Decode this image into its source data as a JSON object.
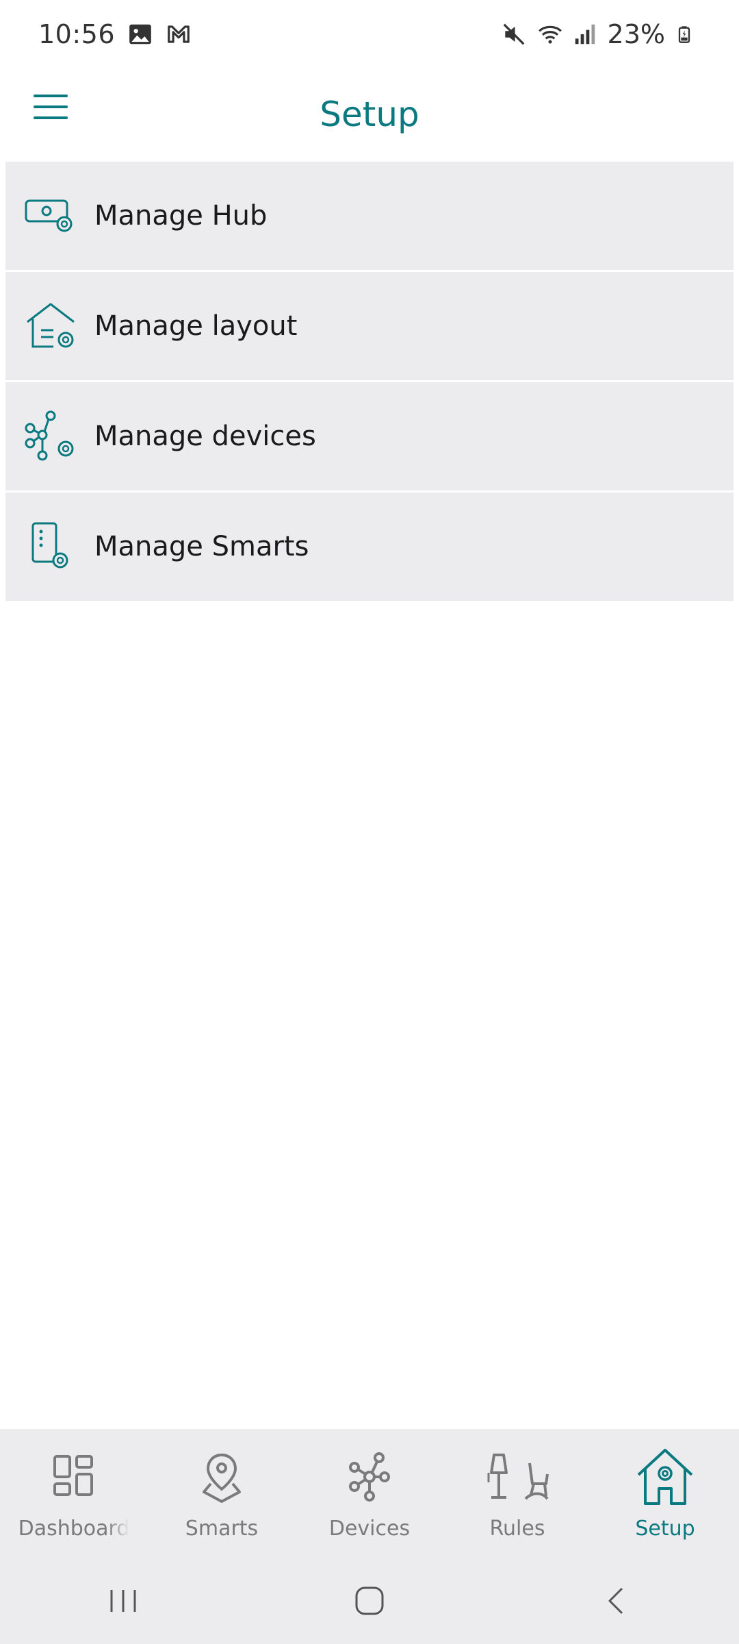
{
  "status_bar": {
    "time": "10:56",
    "battery": "23%",
    "icons": [
      "image-icon",
      "gmail-icon",
      "mute-icon",
      "wifi-icon",
      "signal-icon",
      "battery-icon"
    ]
  },
  "app_bar": {
    "title": "Setup",
    "menu_icon": "hamburger-icon"
  },
  "menu": {
    "items": [
      {
        "label": "Manage Hub",
        "icon": "hub-settings-icon"
      },
      {
        "label": "Manage layout",
        "icon": "layout-settings-icon"
      },
      {
        "label": "Manage devices",
        "icon": "devices-settings-icon"
      },
      {
        "label": "Manage Smarts",
        "icon": "smarts-settings-icon"
      }
    ]
  },
  "bottom_nav": {
    "items": [
      {
        "label": "Dashboard",
        "icon": "dashboard-icon",
        "active": false
      },
      {
        "label": "Smarts",
        "icon": "smarts-icon",
        "active": false
      },
      {
        "label": "Devices",
        "icon": "devices-icon",
        "active": false
      },
      {
        "label": "Rules",
        "icon": "rules-icon",
        "active": false
      },
      {
        "label": "Setup",
        "icon": "setup-icon",
        "active": true
      }
    ]
  },
  "system_nav": {
    "icons": [
      "recents-icon",
      "home-icon",
      "back-icon"
    ]
  },
  "colors": {
    "accent": "#0b7a80",
    "list_bg": "#ececee",
    "inactive": "#7a7a7a"
  }
}
